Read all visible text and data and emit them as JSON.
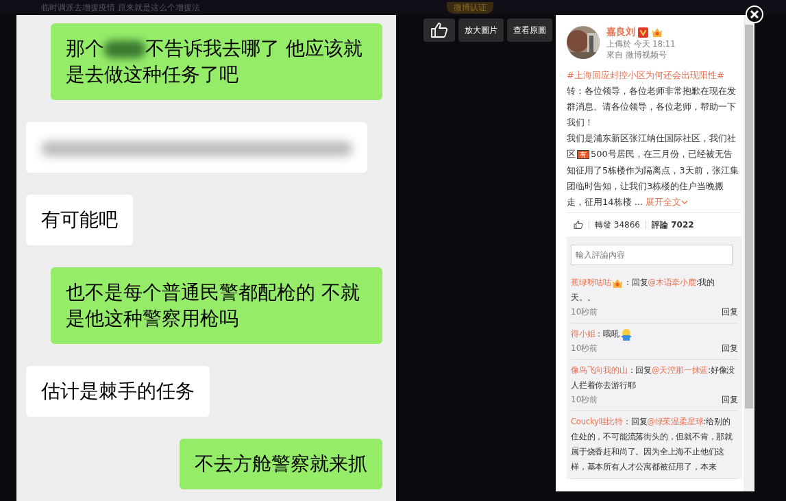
{
  "background": {
    "post_text": "临时调派去增援疫情 原来就是这么个增援法",
    "badge": "微博认证"
  },
  "chat": [
    {
      "kind": "sent",
      "text": "那个",
      "redacted": true,
      "text_after": "不告诉我去哪了 他应该就是去做这种任务了吧"
    },
    {
      "kind": "received",
      "redacted": true
    },
    {
      "kind": "received",
      "text": "有可能吧"
    },
    {
      "kind": "sent",
      "text": "也不是每个普通民警都配枪的 不就是他这种警察用枪吗"
    },
    {
      "kind": "received",
      "text": "估计是棘手的任务"
    },
    {
      "kind": "sent",
      "text": "不去方舱警察就来抓"
    }
  ],
  "toolbar": {
    "buttons": [
      "放大圖片",
      "查看原圖"
    ]
  },
  "panel": {
    "user": "嘉良刘",
    "uploaded": "上傳於 今天 18:11",
    "source": "來自 微博视频号",
    "hashtag": "#上海回应封控小区为何还会出现阳性#",
    "paragraph_1": "转：各位领导，各位老师非常抱歉在现在发群消息。请各位领导，各位老师，帮助一下我们！",
    "paragraph_2": {
      "before": "我们是浦东新区张江纳仕国际社区，我们社区",
      "emoji": "有",
      "after": "500号居民，在三月份，已经被无告知征用了5栋楼作为隔离点，3天前，张江集团临时告知，让我们3栋楼的住户当晚搬走，征用14栋楼 ..."
    },
    "expand": "展开全文",
    "tabs": [
      {
        "label": "轉發 34866",
        "selected": false
      },
      {
        "label": "評論 7022",
        "selected": true
      }
    ],
    "comment_placeholder": "輸入評論內容",
    "comments": [
      {
        "user": "蕉绿呀咕咕",
        "badge": true,
        "colon": "：",
        "verb": "回复",
        "mention": "@木语牵小鹿",
        "text": ":我的天。。",
        "time": "10秒前",
        "reply": "回复"
      },
      {
        "user": "得小姐",
        "colon": "：",
        "text": "哦吼",
        "emoji": true,
        "time": "10秒前",
        "reply": "回复"
      },
      {
        "user": "像鸟飞向我的山",
        "colon": "：",
        "verb": "回复",
        "mention": "@天涳那一抹蓝",
        "text": ":好像没人拦着你去游行耶",
        "time": "10秒前",
        "reply": "回复"
      },
      {
        "user": "Coucky哇比特",
        "colon": "：",
        "verb": "回复",
        "mention": "@绿茱温柔星球",
        "text": ":给别的住处的，不可能流落街头的，但就不肯，那就属于烧香赶和尚了。因为全上海不止他们这样，基本所有人才公寓都被征用了，本来"
      }
    ]
  }
}
